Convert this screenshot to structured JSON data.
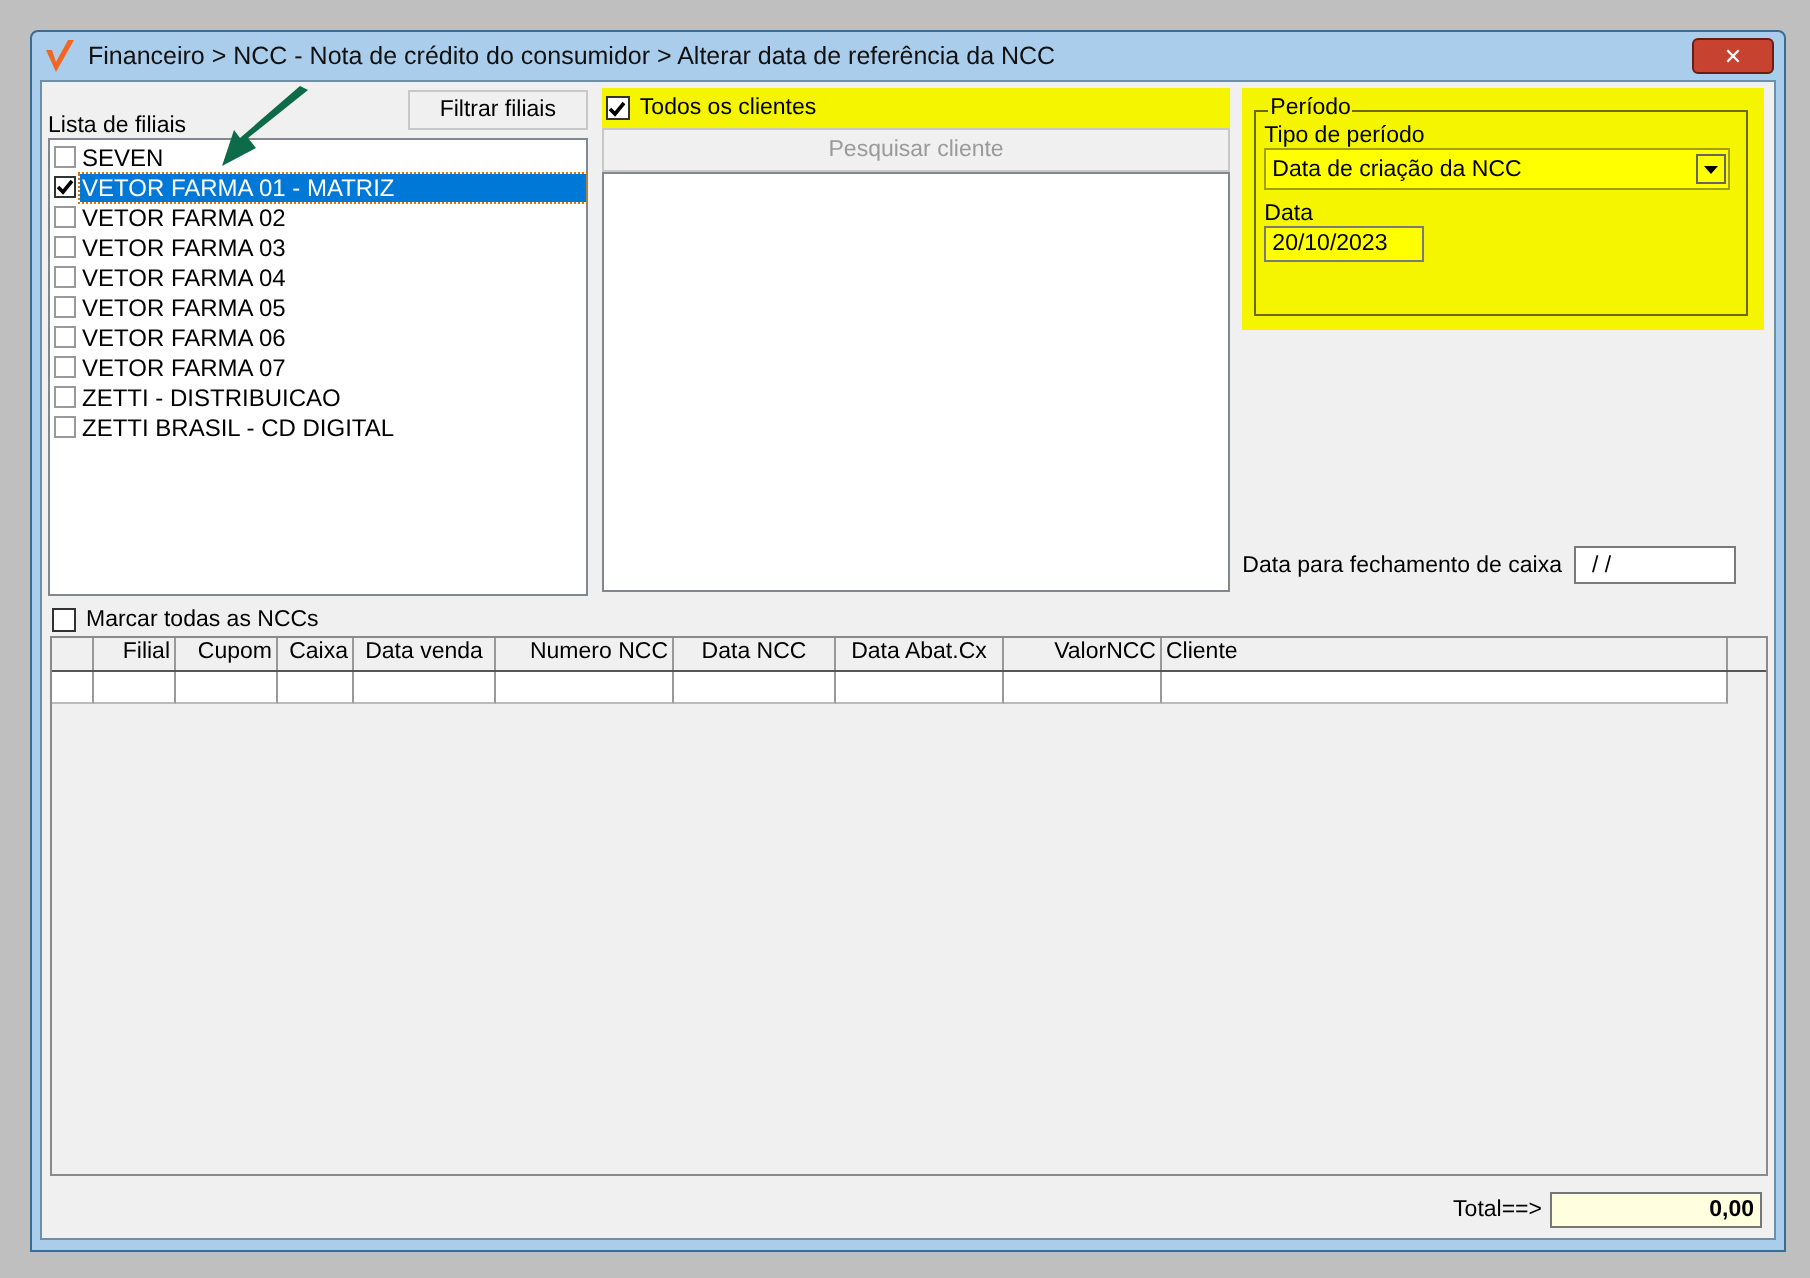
{
  "window": {
    "title": "Financeiro > NCC - Nota de crédito do consumidor > Alterar data de referência da NCC",
    "close": "✕"
  },
  "branches": {
    "label": "Lista de filiais",
    "filter_button": "Filtrar filiais",
    "items": [
      {
        "name": "SEVEN",
        "checked": false,
        "selected": false
      },
      {
        "name": "VETOR FARMA 01 - MATRIZ",
        "checked": true,
        "selected": true
      },
      {
        "name": "VETOR FARMA 02",
        "checked": false,
        "selected": false
      },
      {
        "name": "VETOR FARMA 03",
        "checked": false,
        "selected": false
      },
      {
        "name": "VETOR FARMA 04",
        "checked": false,
        "selected": false
      },
      {
        "name": "VETOR FARMA 05",
        "checked": false,
        "selected": false
      },
      {
        "name": "VETOR FARMA 06",
        "checked": false,
        "selected": false
      },
      {
        "name": "VETOR FARMA 07",
        "checked": false,
        "selected": false
      },
      {
        "name": "ZETTI - DISTRIBUICAO",
        "checked": false,
        "selected": false
      },
      {
        "name": "ZETTI BRASIL - CD DIGITAL",
        "checked": false,
        "selected": false
      }
    ]
  },
  "clients": {
    "all_clients": {
      "label": "Todos os clientes",
      "checked": true
    },
    "search_button": {
      "label": "Pesquisar cliente",
      "disabled": true
    }
  },
  "period": {
    "title": "Período",
    "type_label": "Tipo de período",
    "type_value": "Data de criação da NCC",
    "date_label": "Data",
    "date_value": "20/10/2023"
  },
  "cash_close": {
    "label": "Data para fechamento de caixa",
    "value": "/ /"
  },
  "mark_all": {
    "label": "Marcar todas as NCCs",
    "checked": false
  },
  "table": {
    "columns": [
      {
        "label": "Filial"
      },
      {
        "label": "Cupom"
      },
      {
        "label": "Caixa"
      },
      {
        "label": "Data venda"
      },
      {
        "label": "Numero NCC"
      },
      {
        "label": "Data NCC"
      },
      {
        "label": "Data Abat.Cx"
      },
      {
        "label": "ValorNCC"
      },
      {
        "label": "Cliente"
      }
    ]
  },
  "total": {
    "label": "Total==>",
    "value": "0,00"
  }
}
